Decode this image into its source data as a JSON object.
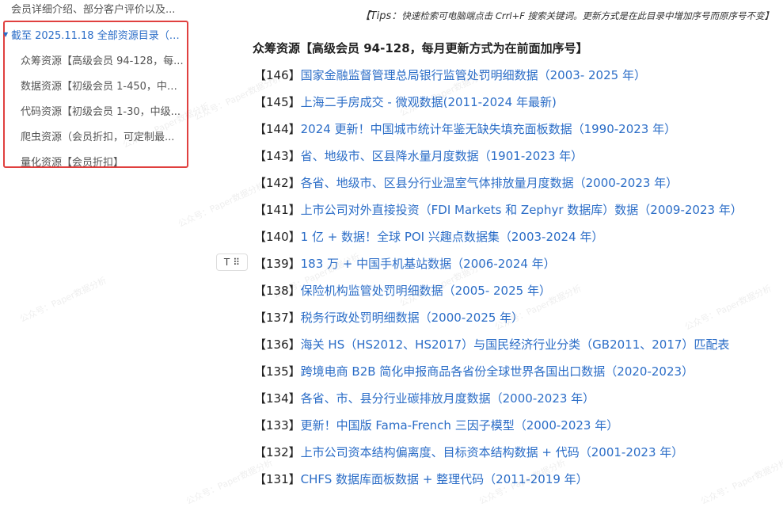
{
  "sidebar": {
    "top_item": "会员详细介绍、部分客户评价以及...",
    "toc_heading": "截至 2025.11.18 全部资源目录（持...",
    "items": [
      "众筹资源【高级会员 94-128，每...",
      "数据资源【初级会员 1-450，中级...",
      "代码资源【初级会员 1-30，中级...",
      "爬虫资源（会员折扣，可定制最...",
      "量化资源【会员折扣】"
    ]
  },
  "tip": {
    "label": "【Tips：",
    "body": "快速检索可电脑端点击 Crrl+F 搜索关键词。更新方式是在此目录中增加序号而原序号不变】"
  },
  "main": {
    "title": "众筹资源【高级会员 94-128，每月更新方式为在前面加序号】",
    "rows": [
      {
        "num": "【146】",
        "text": "国家金融监督管理总局银行监管处罚明细数据（2003- 2025 年）"
      },
      {
        "num": "【145】",
        "text": "上海二手房成交 - 微观数据(2011-2024 年最新)"
      },
      {
        "num": "【144】",
        "text": "2024 更新！中国城市统计年鉴无缺失填充面板数据（1990-2023 年）"
      },
      {
        "num": "【143】",
        "text": "省、地级市、区县降水量月度数据（1901-2023 年）"
      },
      {
        "num": "【142】",
        "text": "各省、地级市、区县分行业温室气体排放量月度数据（2000-2023 年）"
      },
      {
        "num": "【141】",
        "text": "上市公司对外直接投资（FDI Markets 和 Zephyr 数据库）数据（2009-2023 年）"
      },
      {
        "num": "【140】",
        "text": "1 亿 + 数据！全球 POI 兴趣点数据集（2003-2024 年）"
      },
      {
        "num": "【139】",
        "text": "183 万 + 中国手机基站数据（2006-2024 年）"
      },
      {
        "num": "【138】",
        "text": "保险机构监管处罚明细数据（2005- 2025 年）"
      },
      {
        "num": "【137】",
        "text": "税务行政处罚明细数据（2000-2025 年）"
      },
      {
        "num": "【136】",
        "text": "海关 HS（HS2012、HS2017）与国民经济行业分类（GB2011、2017）匹配表"
      },
      {
        "num": "【135】",
        "text": "跨境电商 B2B 简化申报商品各省份全球世界各国出口数据（2020-2023）"
      },
      {
        "num": "【134】",
        "text": "各省、市、县分行业碳排放月度数据（2000-2023 年）"
      },
      {
        "num": "【133】",
        "text": "更新！中国版 Fama-French 三因子模型（2000-2023 年）"
      },
      {
        "num": "【132】",
        "text": "上市公司资本结构偏离度、目标资本结构数据 + 代码（2001-2023 年）"
      },
      {
        "num": "【131】",
        "text": "CHFS 数据库面板数据 + 整理代码（2011-2019 年）"
      }
    ]
  },
  "toolbar": {
    "block_icon": "T",
    "drag_icon": "⠿"
  },
  "watermark": "公众号：Paper数据分析"
}
